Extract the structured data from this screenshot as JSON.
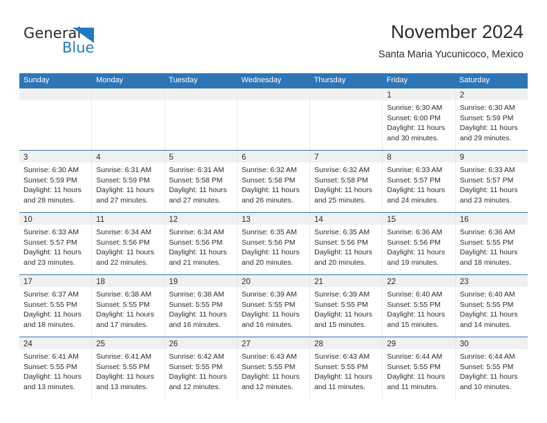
{
  "brand": {
    "name_part1": "General",
    "name_part2": "Blue",
    "triangle_color": "#1f7ac4",
    "blue_text_color": "#1f7ac4"
  },
  "header": {
    "title": "November 2024",
    "subtitle": "Santa Maria Yucunicoco, Mexico"
  },
  "theme": {
    "header_blue": "#2e75b6",
    "daynum_band": "#f0f0f0",
    "grid_line": "#e8e8e8"
  },
  "calendar": {
    "weekdays": [
      "Sunday",
      "Monday",
      "Tuesday",
      "Wednesday",
      "Thursday",
      "Friday",
      "Saturday"
    ],
    "weeks": [
      [
        {
          "day": "",
          "empty": true
        },
        {
          "day": "",
          "empty": true
        },
        {
          "day": "",
          "empty": true
        },
        {
          "day": "",
          "empty": true
        },
        {
          "day": "",
          "empty": true
        },
        {
          "day": "1",
          "sunrise": "Sunrise: 6:30 AM",
          "sunset": "Sunset: 6:00 PM",
          "daylight": "Daylight: 11 hours and 30 minutes."
        },
        {
          "day": "2",
          "sunrise": "Sunrise: 6:30 AM",
          "sunset": "Sunset: 5:59 PM",
          "daylight": "Daylight: 11 hours and 29 minutes."
        }
      ],
      [
        {
          "day": "3",
          "sunrise": "Sunrise: 6:30 AM",
          "sunset": "Sunset: 5:59 PM",
          "daylight": "Daylight: 11 hours and 28 minutes."
        },
        {
          "day": "4",
          "sunrise": "Sunrise: 6:31 AM",
          "sunset": "Sunset: 5:59 PM",
          "daylight": "Daylight: 11 hours and 27 minutes."
        },
        {
          "day": "5",
          "sunrise": "Sunrise: 6:31 AM",
          "sunset": "Sunset: 5:58 PM",
          "daylight": "Daylight: 11 hours and 27 minutes."
        },
        {
          "day": "6",
          "sunrise": "Sunrise: 6:32 AM",
          "sunset": "Sunset: 5:58 PM",
          "daylight": "Daylight: 11 hours and 26 minutes."
        },
        {
          "day": "7",
          "sunrise": "Sunrise: 6:32 AM",
          "sunset": "Sunset: 5:58 PM",
          "daylight": "Daylight: 11 hours and 25 minutes."
        },
        {
          "day": "8",
          "sunrise": "Sunrise: 6:33 AM",
          "sunset": "Sunset: 5:57 PM",
          "daylight": "Daylight: 11 hours and 24 minutes."
        },
        {
          "day": "9",
          "sunrise": "Sunrise: 6:33 AM",
          "sunset": "Sunset: 5:57 PM",
          "daylight": "Daylight: 11 hours and 23 minutes."
        }
      ],
      [
        {
          "day": "10",
          "sunrise": "Sunrise: 6:33 AM",
          "sunset": "Sunset: 5:57 PM",
          "daylight": "Daylight: 11 hours and 23 minutes."
        },
        {
          "day": "11",
          "sunrise": "Sunrise: 6:34 AM",
          "sunset": "Sunset: 5:56 PM",
          "daylight": "Daylight: 11 hours and 22 minutes."
        },
        {
          "day": "12",
          "sunrise": "Sunrise: 6:34 AM",
          "sunset": "Sunset: 5:56 PM",
          "daylight": "Daylight: 11 hours and 21 minutes."
        },
        {
          "day": "13",
          "sunrise": "Sunrise: 6:35 AM",
          "sunset": "Sunset: 5:56 PM",
          "daylight": "Daylight: 11 hours and 20 minutes."
        },
        {
          "day": "14",
          "sunrise": "Sunrise: 6:35 AM",
          "sunset": "Sunset: 5:56 PM",
          "daylight": "Daylight: 11 hours and 20 minutes."
        },
        {
          "day": "15",
          "sunrise": "Sunrise: 6:36 AM",
          "sunset": "Sunset: 5:56 PM",
          "daylight": "Daylight: 11 hours and 19 minutes."
        },
        {
          "day": "16",
          "sunrise": "Sunrise: 6:36 AM",
          "sunset": "Sunset: 5:55 PM",
          "daylight": "Daylight: 11 hours and 18 minutes."
        }
      ],
      [
        {
          "day": "17",
          "sunrise": "Sunrise: 6:37 AM",
          "sunset": "Sunset: 5:55 PM",
          "daylight": "Daylight: 11 hours and 18 minutes."
        },
        {
          "day": "18",
          "sunrise": "Sunrise: 6:38 AM",
          "sunset": "Sunset: 5:55 PM",
          "daylight": "Daylight: 11 hours and 17 minutes."
        },
        {
          "day": "19",
          "sunrise": "Sunrise: 6:38 AM",
          "sunset": "Sunset: 5:55 PM",
          "daylight": "Daylight: 11 hours and 16 minutes."
        },
        {
          "day": "20",
          "sunrise": "Sunrise: 6:39 AM",
          "sunset": "Sunset: 5:55 PM",
          "daylight": "Daylight: 11 hours and 16 minutes."
        },
        {
          "day": "21",
          "sunrise": "Sunrise: 6:39 AM",
          "sunset": "Sunset: 5:55 PM",
          "daylight": "Daylight: 11 hours and 15 minutes."
        },
        {
          "day": "22",
          "sunrise": "Sunrise: 6:40 AM",
          "sunset": "Sunset: 5:55 PM",
          "daylight": "Daylight: 11 hours and 15 minutes."
        },
        {
          "day": "23",
          "sunrise": "Sunrise: 6:40 AM",
          "sunset": "Sunset: 5:55 PM",
          "daylight": "Daylight: 11 hours and 14 minutes."
        }
      ],
      [
        {
          "day": "24",
          "sunrise": "Sunrise: 6:41 AM",
          "sunset": "Sunset: 5:55 PM",
          "daylight": "Daylight: 11 hours and 13 minutes."
        },
        {
          "day": "25",
          "sunrise": "Sunrise: 6:41 AM",
          "sunset": "Sunset: 5:55 PM",
          "daylight": "Daylight: 11 hours and 13 minutes."
        },
        {
          "day": "26",
          "sunrise": "Sunrise: 6:42 AM",
          "sunset": "Sunset: 5:55 PM",
          "daylight": "Daylight: 11 hours and 12 minutes."
        },
        {
          "day": "27",
          "sunrise": "Sunrise: 6:43 AM",
          "sunset": "Sunset: 5:55 PM",
          "daylight": "Daylight: 11 hours and 12 minutes."
        },
        {
          "day": "28",
          "sunrise": "Sunrise: 6:43 AM",
          "sunset": "Sunset: 5:55 PM",
          "daylight": "Daylight: 11 hours and 11 minutes."
        },
        {
          "day": "29",
          "sunrise": "Sunrise: 6:44 AM",
          "sunset": "Sunset: 5:55 PM",
          "daylight": "Daylight: 11 hours and 11 minutes."
        },
        {
          "day": "30",
          "sunrise": "Sunrise: 6:44 AM",
          "sunset": "Sunset: 5:55 PM",
          "daylight": "Daylight: 11 hours and 10 minutes."
        }
      ]
    ]
  }
}
